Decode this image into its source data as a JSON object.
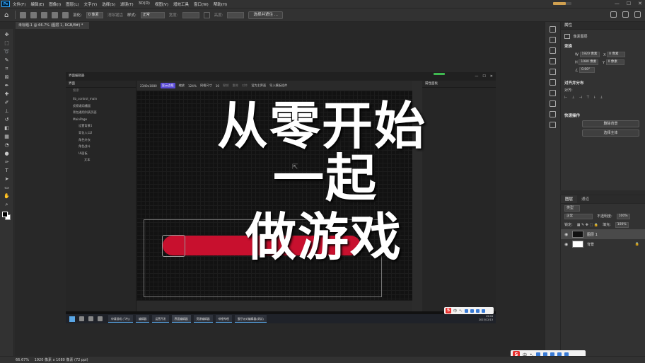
{
  "app": {
    "logo": "Ps",
    "menu": [
      "文件(F)",
      "编辑(E)",
      "图像(I)",
      "图层(L)",
      "文字(Y)",
      "选择(S)",
      "滤镜(T)",
      "3D(D)",
      "视图(V)",
      "增效工具",
      "窗口(W)",
      "帮助(H)"
    ],
    "window_controls": [
      "—",
      "☐",
      "✕"
    ],
    "progress_fraction": 0.7
  },
  "options_bar": {
    "feather_label": "羽化:",
    "feather_value": "0 像素",
    "antialias_label": "消除锯齿",
    "style_label": "样式:",
    "style_value": "正常",
    "width_label": "宽度:",
    "height_label": "高度:",
    "select_subject_button": "选择并遮住 ..."
  },
  "document": {
    "tab_title": "未标题-1 @ 66.7% (图层 1, RGB/8#) *"
  },
  "inner_window": {
    "title": "界面编辑器",
    "left_panel": {
      "header": "界面",
      "search_placeholder": "搜索",
      "tree": [
        "lib_control_main",
        "侦察通用槽面",
        "背包通用列表页面",
        "MainPage",
        "设置背景1",
        "背包入口2",
        "角色外衣",
        "角色战斗",
        "UI面板",
        "文本"
      ]
    },
    "toolbar": {
      "resolution": "2340x1080",
      "device_button": "显示边框",
      "zoom_label": "缩放",
      "zoom_value": "124%",
      "grid_label": "网格尺寸",
      "grid_value": "10",
      "undo": "撤销",
      "redo": "重做",
      "align": "对齐",
      "set_main": "设为主界面",
      "import_template": "导入模板组件"
    },
    "right_panel": {
      "header": "属性面板"
    }
  },
  "overlay": {
    "line1": "从零开始",
    "line2": "一起",
    "line3": "做游戏"
  },
  "taskbar": {
    "apps": [
      "申请游戏 (「冲」)",
      "编辑器",
      "运营开发",
      "界面编辑器",
      "资源编辑器",
      "哔哩哔哩",
      "蛋仔派对编辑器(调试)"
    ],
    "time": "15:04",
    "date": "2023/12/13"
  },
  "ime": {
    "logo": "S",
    "mode": "中",
    "punct": "•,"
  },
  "properties": {
    "tab": "属性",
    "layer_type": "像素图层",
    "transform_title": "变换",
    "w_label": "W",
    "w_value": "1920 像素",
    "h_label": "H",
    "h_value": "1080 像素",
    "x_label": "X",
    "x_value": "0 像素",
    "y_label": "Y",
    "y_value": "0 像素",
    "angle_value": "0.00°",
    "align_title": "对齐并分布",
    "align_sub": "对齐:",
    "quick_actions_title": "快速操作",
    "remove_bg_button": "删除背景",
    "select_subject_button": "选择主体"
  },
  "layers_panel": {
    "tabs": [
      "图层",
      "通道"
    ],
    "kind_label": "类型",
    "blend_mode": "正常",
    "opacity_label": "不透明度:",
    "opacity_value": "100%",
    "lock_label": "锁定:",
    "fill_label": "填充:",
    "fill_value": "100%",
    "layers": [
      {
        "name": "图层 1",
        "selected": true,
        "thumb": "black"
      },
      {
        "name": "背景",
        "selected": false,
        "thumb": "white"
      }
    ]
  },
  "status_bar": {
    "zoom": "66.67%",
    "doc_info": "1920 像素 x 1080 像素 (72 ppi)"
  },
  "colors": {
    "red_bar": "#c8102e",
    "accent_blue": "#5a4bd6"
  }
}
